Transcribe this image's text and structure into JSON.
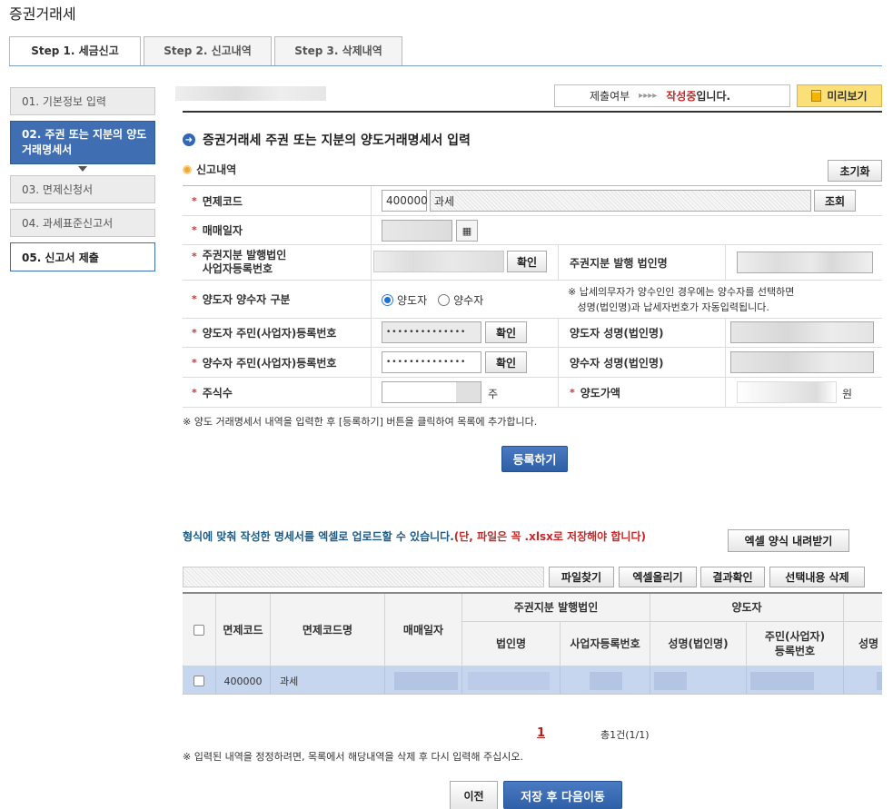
{
  "page_title": "증권거래세",
  "tabs": [
    {
      "label": "Step 1. 세금신고"
    },
    {
      "label": "Step 2. 신고내역"
    },
    {
      "label": "Step 3. 삭제내역"
    }
  ],
  "steps": [
    {
      "label": "01. 기본정보 입력"
    },
    {
      "label": "02. 주권 또는 지분의 양도거래명세서"
    },
    {
      "label": "03. 면제신청서"
    },
    {
      "label": "04. 과세표준신고서"
    },
    {
      "label": "05. 신고서 제출"
    }
  ],
  "status": {
    "prefix": "제출여부",
    "arrows": "▸▸▸▸",
    "state_red": "작성중",
    "state_suffix": "입니다.",
    "preview_label": "미리보기"
  },
  "section_title": "증권거래세 주권 또는 지분의 양도거래명세서 입력",
  "subsection_title": "신고내역",
  "reset_label": "초기화",
  "form": {
    "exemption_code_label": "면제코드",
    "exemption_code_value": "400000",
    "exemption_code_name": "과세",
    "lookup_label": "조회",
    "trade_date_label": "매매일자",
    "issuer_brn_label": "주권지분 발행법인\n사업자등록번호",
    "confirm_label": "확인",
    "issuer_name_label": "주권지분 발행 법인명",
    "party_type_label": "양도자 양수자 구분",
    "option_seller": "양도자",
    "option_buyer": "양수자",
    "party_note": "※ 납세의무자가 양수인인 경우에는 양수자를 선택하면\n   성명(법인명)과 납세자번호가 자동입력됩니다.",
    "seller_id_label": "양도자 주민(사업자)등록번호",
    "seller_id_value": "••••••••••••••",
    "seller_name_label": "양도자 성명(법인명)",
    "buyer_id_label": "양수자 주민(사업자)등록번호",
    "buyer_id_value": "••••••••••••••",
    "buyer_name_label": "양수자 성명(법인명)",
    "shares_label": "주식수",
    "shares_unit": "주",
    "price_label": "양도가액",
    "price_unit": "원"
  },
  "note_register": "※ 양도 거래명세서 내역을 입력한 후 [등록하기] 버튼을 클릭하여 목록에 추가합니다.",
  "register_label": "등록하기",
  "upload_text": "형식에 맞춰 작성한 명세서를 엑셀로 업로드할 수 있습니다.",
  "upload_warning": "(단, 파일은 꼭 .xlsx로 저장해야 합니다)",
  "excel_download_label": "엑셀 양식 내려받기",
  "file_buttons": [
    "파일찾기",
    "엑셀올리기",
    "결과확인",
    "선택내용 삭제"
  ],
  "grid": {
    "headers": {
      "code": "면제코드",
      "code_name": "면제코드명",
      "trade_date": "매매일자",
      "issuer_group": "주권지분 발행법인",
      "issuer_name": "법인명",
      "issuer_brn": "사업자등록번호",
      "seller_group": "양도자",
      "seller_name": "성명(법인명)",
      "seller_id": "주민(사업자)\n등록번호",
      "buyer_name_partial": "성명"
    },
    "row": {
      "code": "400000",
      "code_name": "과세"
    }
  },
  "pagination": {
    "current": "1",
    "summary": "총1건(1/1)"
  },
  "note_edit": "※ 입력된 내역을 정정하려면, 목록에서 해당내역을 삭제 후 다시 입력해 주십시오.",
  "prev_label": "이전",
  "save_next_label": "저장 후 다음이동"
}
